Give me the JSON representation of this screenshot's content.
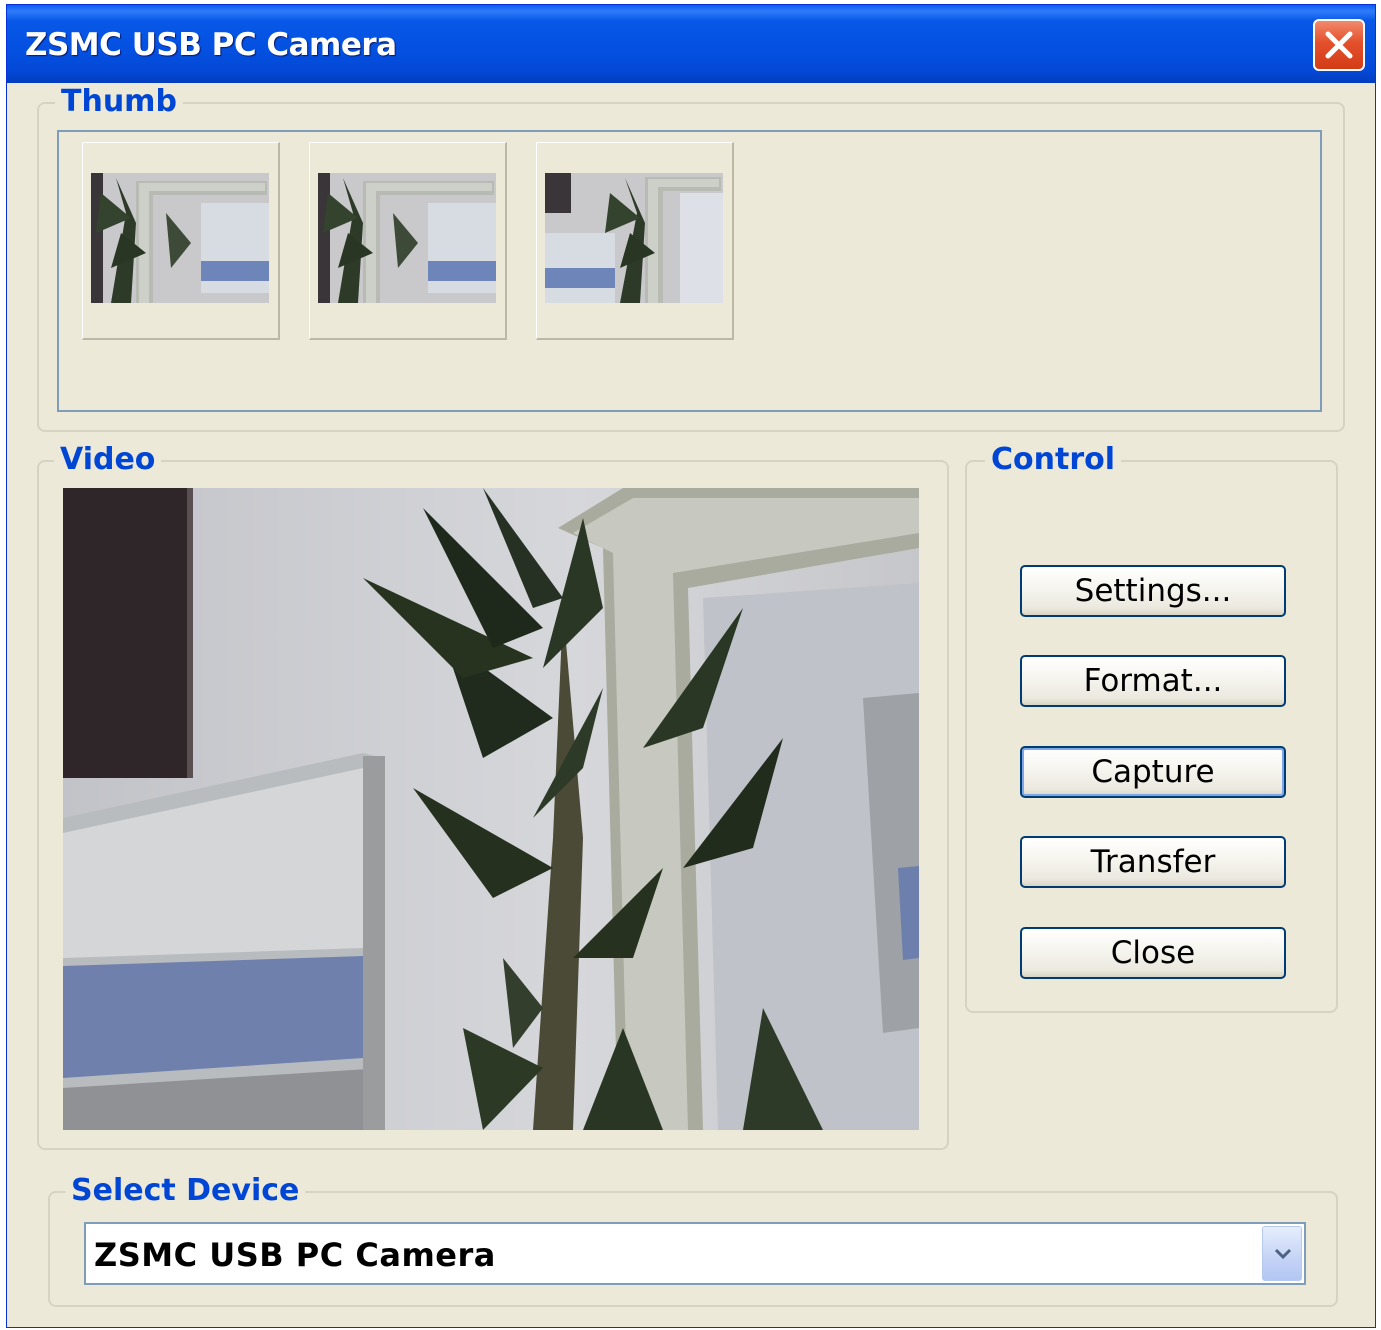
{
  "window": {
    "title": "ZSMC USB PC Camera"
  },
  "thumb_group": {
    "label": "Thumb",
    "thumbnails": [
      {
        "name": "thumbnail-1"
      },
      {
        "name": "thumbnail-2"
      },
      {
        "name": "thumbnail-3"
      }
    ]
  },
  "video_group": {
    "label": "Video"
  },
  "control_group": {
    "label": "Control",
    "buttons": {
      "settings": "Settings...",
      "format": "Format...",
      "capture": "Capture",
      "transfer": "Transfer",
      "close": "Close"
    }
  },
  "device_group": {
    "label": "Select Device",
    "selected": "ZSMC USB PC Camera"
  },
  "colors": {
    "titlebar": "#0450e0",
    "window_bg": "#ece9d8",
    "legend_text": "#0046d5",
    "close_button": "#d23d16",
    "button_border": "#003c74"
  }
}
